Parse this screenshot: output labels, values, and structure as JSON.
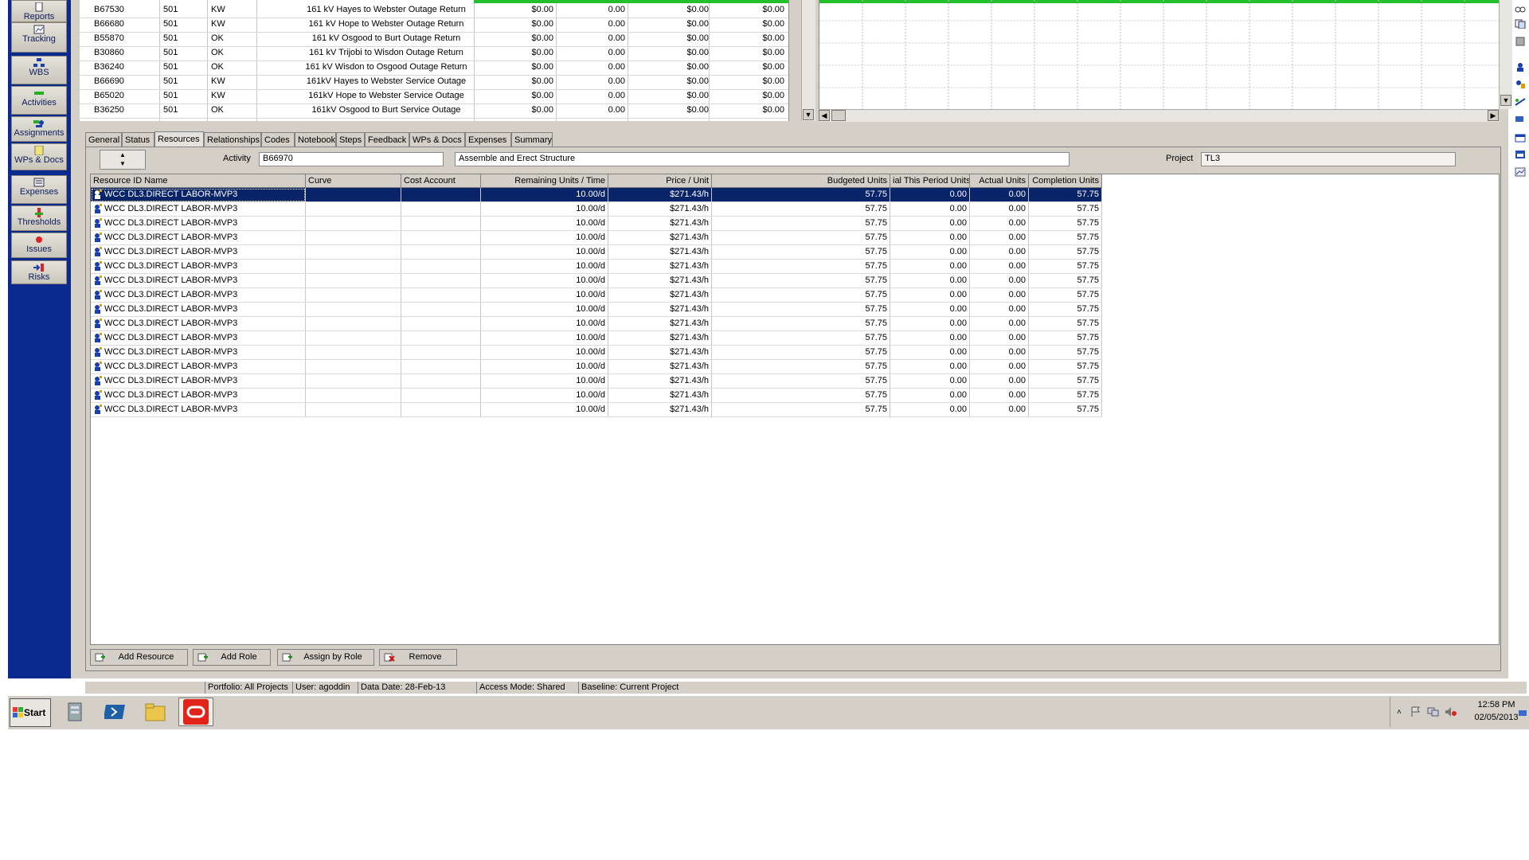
{
  "nav": {
    "items": [
      {
        "label": "Reports"
      },
      {
        "label": "Tracking"
      },
      {
        "label": "WBS"
      },
      {
        "label": "Activities"
      },
      {
        "label": "Assignments"
      },
      {
        "label": "WPs & Docs"
      },
      {
        "label": "Expenses"
      },
      {
        "label": "Thresholds"
      },
      {
        "label": "Issues"
      },
      {
        "label": "Risks"
      }
    ]
  },
  "activities": [
    {
      "id": "B67530",
      "code": "501",
      "resp": "KW",
      "name": "161 kV Hayes to Webster Outage Return",
      "c1": "$0.00",
      "c2": "0.00",
      "c3": "$0.00",
      "c4": "$0.00"
    },
    {
      "id": "B66680",
      "code": "501",
      "resp": "KW",
      "name": "161 kV Hope to Webster Outage Return",
      "c1": "$0.00",
      "c2": "0.00",
      "c3": "$0.00",
      "c4": "$0.00"
    },
    {
      "id": "B55870",
      "code": "501",
      "resp": "OK",
      "name": "161 kV Osgood to Burt Outage Return",
      "c1": "$0.00",
      "c2": "0.00",
      "c3": "$0.00",
      "c4": "$0.00"
    },
    {
      "id": "B30860",
      "code": "501",
      "resp": "OK",
      "name": "161 kV Trijobi to Wisdon Outage Return",
      "c1": "$0.00",
      "c2": "0.00",
      "c3": "$0.00",
      "c4": "$0.00"
    },
    {
      "id": "B36240",
      "code": "501",
      "resp": "OK",
      "name": "161 kV Wisdon to Osgood Outage Return",
      "c1": "$0.00",
      "c2": "0.00",
      "c3": "$0.00",
      "c4": "$0.00"
    },
    {
      "id": "B66690",
      "code": "501",
      "resp": "KW",
      "name": "161kV Hayes to Webster Service Outage",
      "c1": "$0.00",
      "c2": "0.00",
      "c3": "$0.00",
      "c4": "$0.00"
    },
    {
      "id": "B65020",
      "code": "501",
      "resp": "KW",
      "name": "161kV Hope to Webster Service Outage",
      "c1": "$0.00",
      "c2": "0.00",
      "c3": "$0.00",
      "c4": "$0.00"
    },
    {
      "id": "B36250",
      "code": "501",
      "resp": "OK",
      "name": "161kV Osgood to Burt Service Outage",
      "c1": "$0.00",
      "c2": "0.00",
      "c3": "$0.00",
      "c4": "$0.00"
    }
  ],
  "tabs": [
    {
      "label": "General"
    },
    {
      "label": "Status"
    },
    {
      "label": "Resources"
    },
    {
      "label": "Relationships"
    },
    {
      "label": "Codes"
    },
    {
      "label": "Notebook"
    },
    {
      "label": "Steps"
    },
    {
      "label": "Feedback"
    },
    {
      "label": "WPs & Docs"
    },
    {
      "label": "Expenses"
    },
    {
      "label": "Summary"
    }
  ],
  "details": {
    "activity_label": "Activity",
    "activity_id": "B66970",
    "activity_name": "Assemble and Erect Structure",
    "project_label": "Project",
    "project_id": "TL3"
  },
  "grid": {
    "columns": [
      "Resource ID Name",
      "Curve",
      "Cost Account",
      "Remaining Units / Time",
      "Price / Unit",
      "Budgeted Units",
      "ial This Period Units",
      "Actual Units",
      "Completion Units"
    ],
    "rows": [
      {
        "name": "WCC DL3.DIRECT LABOR-MVP3",
        "curve": "",
        "account": "",
        "rem": "10.00/d",
        "price": "$271.43/h",
        "budget": "57.75",
        "period": "0.00",
        "actual": "0.00",
        "completion": "57.75"
      },
      {
        "name": "WCC DL3.DIRECT LABOR-MVP3",
        "curve": "",
        "account": "",
        "rem": "10.00/d",
        "price": "$271.43/h",
        "budget": "57.75",
        "period": "0.00",
        "actual": "0.00",
        "completion": "57.75"
      },
      {
        "name": "WCC DL3.DIRECT LABOR-MVP3",
        "curve": "",
        "account": "",
        "rem": "10.00/d",
        "price": "$271.43/h",
        "budget": "57.75",
        "period": "0.00",
        "actual": "0.00",
        "completion": "57.75"
      },
      {
        "name": "WCC DL3.DIRECT LABOR-MVP3",
        "curve": "",
        "account": "",
        "rem": "10.00/d",
        "price": "$271.43/h",
        "budget": "57.75",
        "period": "0.00",
        "actual": "0.00",
        "completion": "57.75"
      },
      {
        "name": "WCC DL3.DIRECT LABOR-MVP3",
        "curve": "",
        "account": "",
        "rem": "10.00/d",
        "price": "$271.43/h",
        "budget": "57.75",
        "period": "0.00",
        "actual": "0.00",
        "completion": "57.75"
      },
      {
        "name": "WCC DL3.DIRECT LABOR-MVP3",
        "curve": "",
        "account": "",
        "rem": "10.00/d",
        "price": "$271.43/h",
        "budget": "57.75",
        "period": "0.00",
        "actual": "0.00",
        "completion": "57.75"
      },
      {
        "name": "WCC DL3.DIRECT LABOR-MVP3",
        "curve": "",
        "account": "",
        "rem": "10.00/d",
        "price": "$271.43/h",
        "budget": "57.75",
        "period": "0.00",
        "actual": "0.00",
        "completion": "57.75"
      },
      {
        "name": "WCC DL3.DIRECT LABOR-MVP3",
        "curve": "",
        "account": "",
        "rem": "10.00/d",
        "price": "$271.43/h",
        "budget": "57.75",
        "period": "0.00",
        "actual": "0.00",
        "completion": "57.75"
      },
      {
        "name": "WCC DL3.DIRECT LABOR-MVP3",
        "curve": "",
        "account": "",
        "rem": "10.00/d",
        "price": "$271.43/h",
        "budget": "57.75",
        "period": "0.00",
        "actual": "0.00",
        "completion": "57.75"
      },
      {
        "name": "WCC DL3.DIRECT LABOR-MVP3",
        "curve": "",
        "account": "",
        "rem": "10.00/d",
        "price": "$271.43/h",
        "budget": "57.75",
        "period": "0.00",
        "actual": "0.00",
        "completion": "57.75"
      },
      {
        "name": "WCC DL3.DIRECT LABOR-MVP3",
        "curve": "",
        "account": "",
        "rem": "10.00/d",
        "price": "$271.43/h",
        "budget": "57.75",
        "period": "0.00",
        "actual": "0.00",
        "completion": "57.75"
      },
      {
        "name": "WCC DL3.DIRECT LABOR-MVP3",
        "curve": "",
        "account": "",
        "rem": "10.00/d",
        "price": "$271.43/h",
        "budget": "57.75",
        "period": "0.00",
        "actual": "0.00",
        "completion": "57.75"
      },
      {
        "name": "WCC DL3.DIRECT LABOR-MVP3",
        "curve": "",
        "account": "",
        "rem": "10.00/d",
        "price": "$271.43/h",
        "budget": "57.75",
        "period": "0.00",
        "actual": "0.00",
        "completion": "57.75"
      },
      {
        "name": "WCC DL3.DIRECT LABOR-MVP3",
        "curve": "",
        "account": "",
        "rem": "10.00/d",
        "price": "$271.43/h",
        "budget": "57.75",
        "period": "0.00",
        "actual": "0.00",
        "completion": "57.75"
      },
      {
        "name": "WCC DL3.DIRECT LABOR-MVP3",
        "curve": "",
        "account": "",
        "rem": "10.00/d",
        "price": "$271.43/h",
        "budget": "57.75",
        "period": "0.00",
        "actual": "0.00",
        "completion": "57.75"
      },
      {
        "name": "WCC DL3.DIRECT LABOR-MVP3",
        "curve": "",
        "account": "",
        "rem": "10.00/d",
        "price": "$271.43/h",
        "budget": "57.75",
        "period": "0.00",
        "actual": "0.00",
        "completion": "57.75"
      }
    ]
  },
  "buttons": {
    "add_resource": "Add Resource",
    "add_role": "Add Role",
    "assign_by_role": "Assign by Role",
    "remove": "Remove"
  },
  "status": {
    "portfolio": "Portfolio: All Projects",
    "user": "User: agoddin",
    "data_date": "Data Date: 28-Feb-13",
    "access": "Access Mode: Shared",
    "baseline": "Baseline: Current Project"
  },
  "taskbar": {
    "start": "Start",
    "time": "12:58 PM",
    "date": "02/05/2013"
  },
  "colors": {
    "nav_bg": "#0b2a8f",
    "selection": "#0a246a",
    "gantt_bar": "#22c02a",
    "oracle_red": "#e2231a"
  }
}
